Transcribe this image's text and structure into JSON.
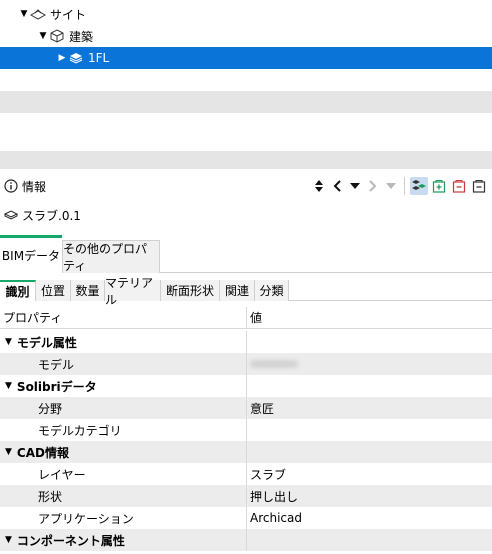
{
  "tree": {
    "rows": [
      {
        "label": "サイト",
        "expander": "▼"
      },
      {
        "label": "建築",
        "expander": "▼"
      },
      {
        "label": "1FL",
        "expander": "▶"
      }
    ]
  },
  "info": {
    "title": "情報",
    "object_name": "スラブ.0.1"
  },
  "tabs_primary": [
    {
      "label": "BIMデータ",
      "active": true
    },
    {
      "label": "その他のプロパティ",
      "active": false
    }
  ],
  "tabs_secondary": [
    {
      "label": "識別",
      "active": true
    },
    {
      "label": "位置"
    },
    {
      "label": "数量"
    },
    {
      "label": "マテリアル"
    },
    {
      "label": "断面形状"
    },
    {
      "label": "関連"
    },
    {
      "label": "分類"
    }
  ],
  "table": {
    "header": {
      "property": "プロパティ",
      "value": "値"
    },
    "rows": [
      {
        "type": "group",
        "label": "モデル属性"
      },
      {
        "type": "item",
        "label": "モデル",
        "value": ""
      },
      {
        "type": "group",
        "label": "Solibriデータ"
      },
      {
        "type": "item",
        "label": "分野",
        "value": "意匠"
      },
      {
        "type": "item",
        "label": "モデルカテゴリ",
        "value": ""
      },
      {
        "type": "group",
        "label": "CAD情報"
      },
      {
        "type": "item",
        "label": "レイヤー",
        "value": "スラブ"
      },
      {
        "type": "item",
        "label": "形状",
        "value": "押し出し"
      },
      {
        "type": "item",
        "label": "アプリケーション",
        "value": "Archicad"
      },
      {
        "type": "group",
        "label": "コンポーネント属性"
      }
    ]
  },
  "colors": {
    "selection": "#0a74d8",
    "tab_accent": "#16a86a",
    "row_stripe": "#ececec"
  }
}
